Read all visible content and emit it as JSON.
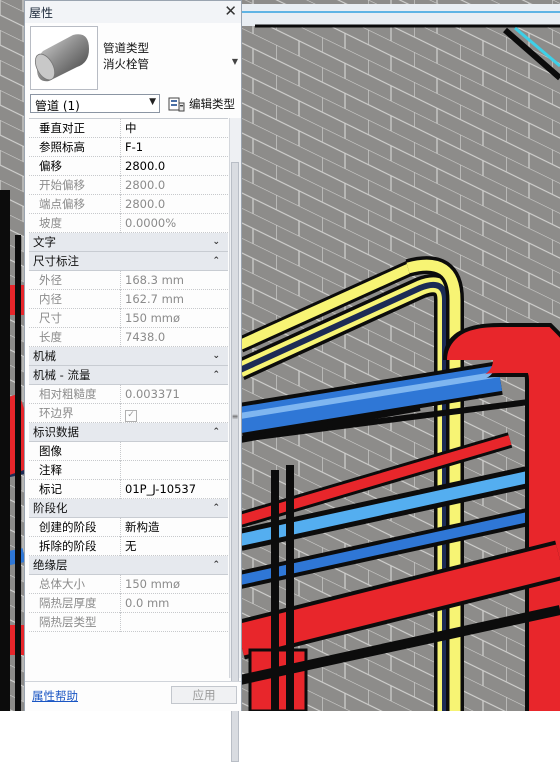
{
  "palette": {
    "title": "屋性",
    "type_name_line1": "管道类型",
    "type_name_line2": "消火栓管",
    "filter_value": "管道 (1)",
    "edit_type_label": "编辑类型",
    "help_link": "属性帮助",
    "apply_button": "应用"
  },
  "rows": [
    {
      "kind": "prop",
      "name": "垂直对正",
      "value": "中",
      "disabled": false
    },
    {
      "kind": "prop",
      "name": "参照标高",
      "value": "F-1",
      "disabled": false
    },
    {
      "kind": "prop",
      "name": "偏移",
      "value": "2800.0",
      "disabled": false
    },
    {
      "kind": "prop",
      "name": "开始偏移",
      "value": "2800.0",
      "disabled": true
    },
    {
      "kind": "prop",
      "name": "端点偏移",
      "value": "2800.0",
      "disabled": true
    },
    {
      "kind": "prop",
      "name": "坡度",
      "value": "0.0000%",
      "disabled": true
    },
    {
      "kind": "section",
      "name": "文字",
      "collapsed": true
    },
    {
      "kind": "section",
      "name": "尺寸标注",
      "collapsed": false
    },
    {
      "kind": "prop",
      "name": "外径",
      "value": "168.3 mm",
      "disabled": true
    },
    {
      "kind": "prop",
      "name": "内径",
      "value": "162.7 mm",
      "disabled": true
    },
    {
      "kind": "prop",
      "name": "尺寸",
      "value": "150 mmø",
      "disabled": true
    },
    {
      "kind": "prop",
      "name": "长度",
      "value": "7438.0",
      "disabled": true
    },
    {
      "kind": "section",
      "name": "机械",
      "collapsed": true
    },
    {
      "kind": "section",
      "name": "机械 - 流量",
      "collapsed": false
    },
    {
      "kind": "prop",
      "name": "相对粗糙度",
      "value": "0.003371",
      "disabled": true
    },
    {
      "kind": "prop",
      "name": "环边界",
      "value": "checkbox",
      "checked": true,
      "disabled": true
    },
    {
      "kind": "section",
      "name": "标识数据",
      "collapsed": false
    },
    {
      "kind": "prop",
      "name": "图像",
      "value": "",
      "disabled": false
    },
    {
      "kind": "prop",
      "name": "注释",
      "value": "",
      "disabled": false
    },
    {
      "kind": "prop",
      "name": "标记",
      "value": "01P_J-10537",
      "disabled": false
    },
    {
      "kind": "section",
      "name": "阶段化",
      "collapsed": false
    },
    {
      "kind": "prop",
      "name": "创建的阶段",
      "value": "新构造",
      "disabled": false
    },
    {
      "kind": "prop",
      "name": "拆除的阶段",
      "value": "无",
      "disabled": false
    },
    {
      "kind": "section",
      "name": "绝缘层",
      "collapsed": false
    },
    {
      "kind": "prop",
      "name": "总体大小",
      "value": "150 mmø",
      "disabled": true
    },
    {
      "kind": "prop",
      "name": "隔热层厚度",
      "value": "0.0 mm",
      "disabled": true
    },
    {
      "kind": "prop",
      "name": "隔热层类型",
      "value": "",
      "disabled": true
    }
  ],
  "icons": {
    "close": "close-icon",
    "type_thumbnail": "pipe-thumbnail-icon",
    "edit_type": "edit-type-icon",
    "collapse": "chevron-up-icon",
    "expand": "chevron-down-icon"
  },
  "colors": {
    "pipe_red": "#e8262b",
    "pipe_yellow": "#f6f26c",
    "pipe_blue": "#2f77d6",
    "pipe_navy": "#1f2c57",
    "wall": "#8a8a88"
  }
}
